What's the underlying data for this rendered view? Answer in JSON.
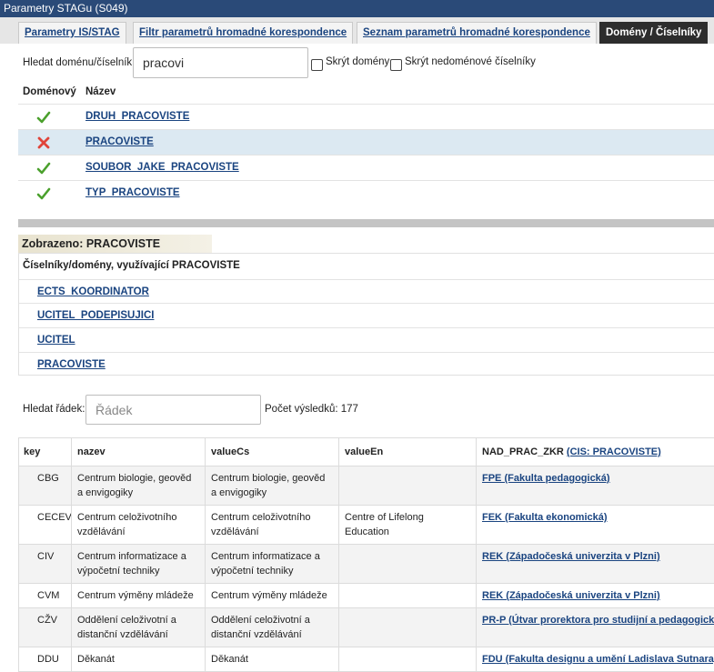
{
  "window": {
    "title": "Parametry STAGu (S049)"
  },
  "tabs": [
    {
      "label": "Parametry IS/STAG"
    },
    {
      "label": "Filtr parametrů hromadné korespondence"
    },
    {
      "label": "Seznam parametrů hromadné korespondence"
    },
    {
      "label": "Domény / Číselníky"
    }
  ],
  "domain_search": {
    "label": "Hledat doménu/číselník:",
    "value": "pracovi",
    "hide_domains_label": "Skrýt domény",
    "hide_nondomain_label": "Skrýt nedoménové číselníky"
  },
  "domain_table": {
    "col_domain": "Doménový",
    "col_name": "Název",
    "rows": [
      {
        "name": "DRUH_PRACOVISTE",
        "icon": "check-icon",
        "selected": false
      },
      {
        "name": "PRACOVISTE",
        "icon": "cross-icon",
        "selected": true
      },
      {
        "name": "SOUBOR_JAKE_PRACOVISTE",
        "icon": "check-icon",
        "selected": false
      },
      {
        "name": "TYP_PRACOVISTE",
        "icon": "check-icon",
        "selected": false
      }
    ]
  },
  "shown": {
    "label": "Zobrazeno: PRACOVISTE"
  },
  "usage": {
    "header": "Číselníky/domény, využívající PRACOVISTE",
    "items": [
      "ECTS_KOORDINATOR",
      "UCITEL_PODEPISUJICI",
      "UCITEL",
      "PRACOVISTE"
    ]
  },
  "row_search": {
    "label": "Hledat řádek:",
    "placeholder": "Řádek",
    "count_label": "Počet výsledků: 177"
  },
  "results": {
    "columns": {
      "key": "key",
      "nazev": "nazev",
      "valueCs": "valueCs",
      "valueEn": "valueEn",
      "nad": "NAD_PRAC_ZKR",
      "nad_link": "(CIS: PRACOVISTE)"
    },
    "rows": [
      {
        "key": "CBG",
        "nazev": "Centrum biologie, geověd a envigogiky",
        "valueCs": "Centrum biologie, geověd a envigogiky",
        "valueEn": "",
        "nad": "FPE (Fakulta pedagogická)"
      },
      {
        "key": "CECEV",
        "nazev": "Centrum celoživotního vzdělávání",
        "valueCs": "Centrum celoživotního vzdělávání",
        "valueEn": "Centre of Lifelong Education",
        "nad": "FEK (Fakulta ekonomická)"
      },
      {
        "key": "CIV",
        "nazev": "Centrum informatizace a výpočetní techniky",
        "valueCs": "Centrum informatizace a výpočetní techniky",
        "valueEn": "",
        "nad": "REK (Západočeská univerzita v Plzni)"
      },
      {
        "key": "CVM",
        "nazev": "Centrum výměny mládeže",
        "valueCs": "Centrum výměny mládeže",
        "valueEn": "",
        "nad": "REK (Západočeská univerzita v Plzni)"
      },
      {
        "key": "CŽV",
        "nazev": "Oddělení celoživotní a distanční vzdělávání",
        "valueCs": "Oddělení celoživotní a distanční vzdělávání",
        "valueEn": "",
        "nad": "PR-P (Útvar prorektora pro studijní a pedagogickou činnost)"
      },
      {
        "key": "DDU",
        "nazev": "Děkanát",
        "valueCs": "Děkanát",
        "valueEn": "",
        "nad": "FDU (Fakulta designu a umění Ladislava Sutnara)"
      }
    ]
  },
  "colors": {
    "accent": "#1a4480",
    "titlebar": "#2a4a78",
    "selected_row": "#dce9f2",
    "check": "#4aa02c",
    "cross": "#e0443a"
  }
}
